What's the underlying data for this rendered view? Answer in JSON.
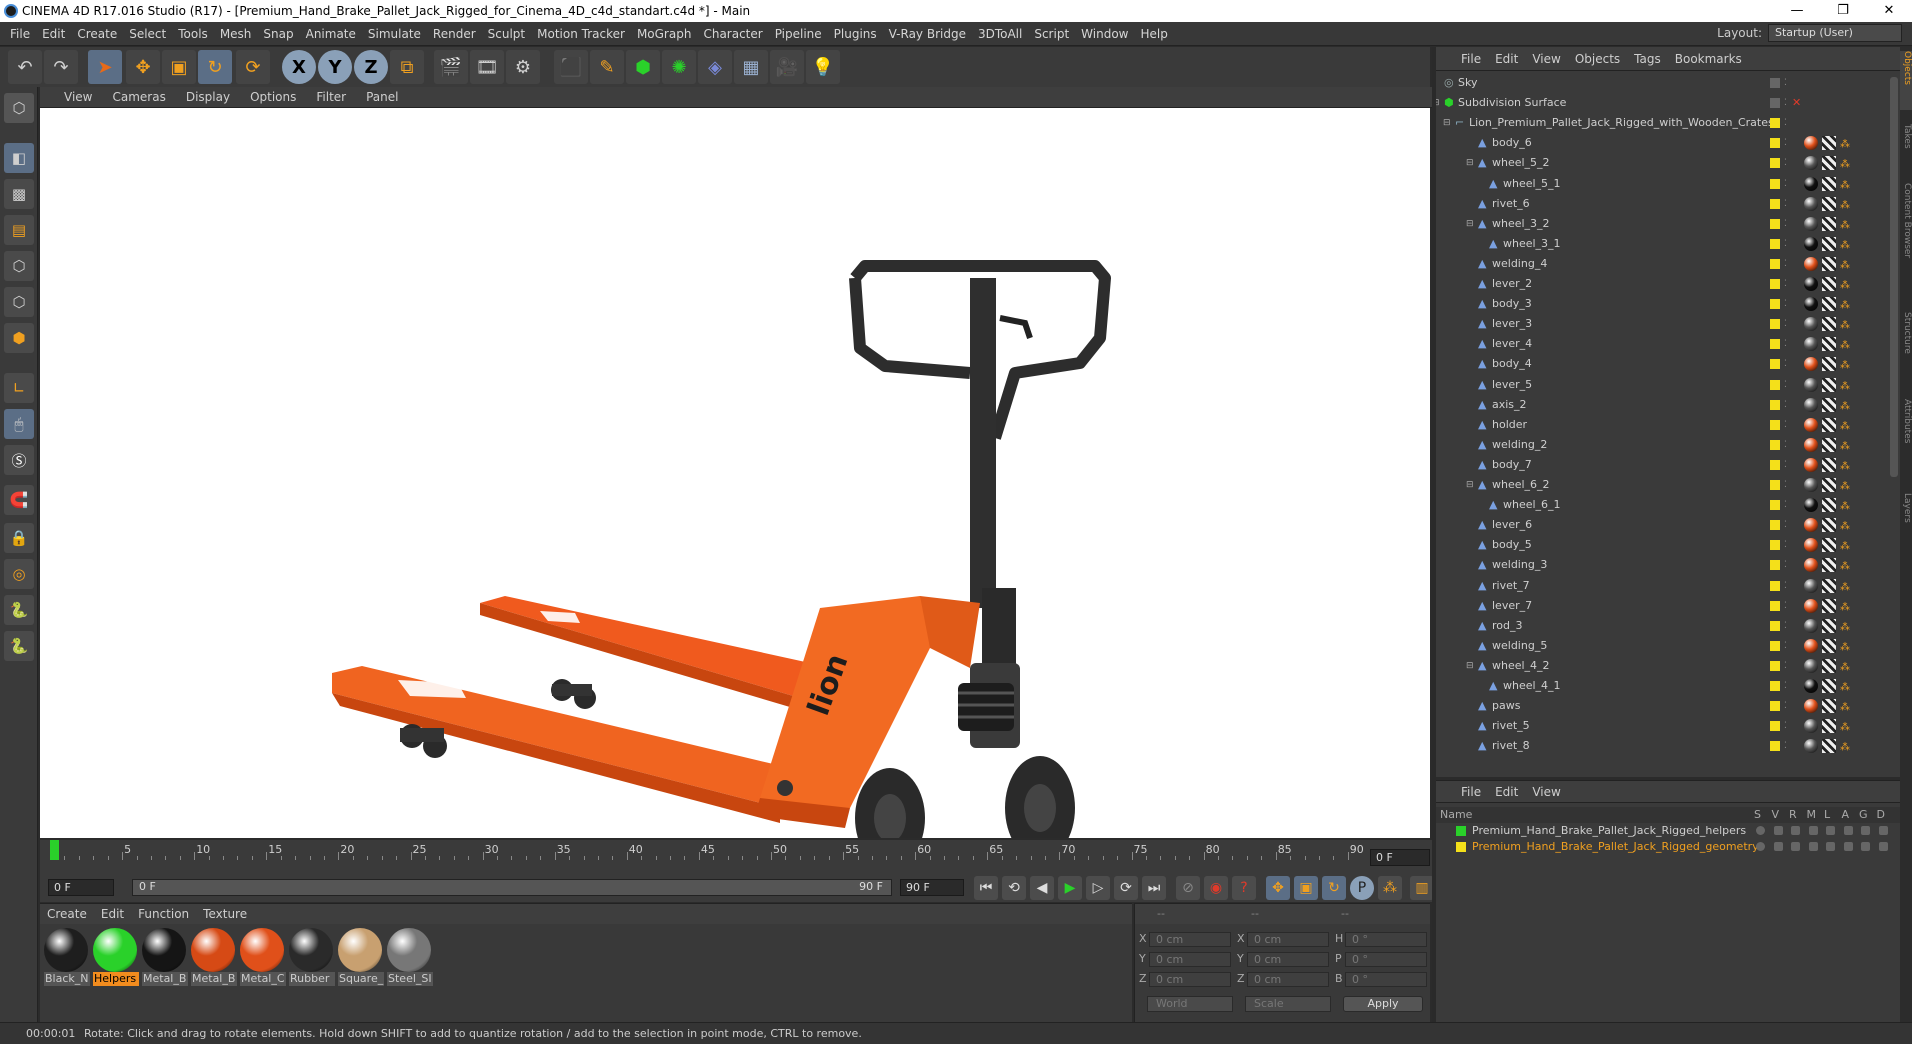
{
  "window": {
    "title": "CINEMA 4D R17.016 Studio (R17) - [Premium_Hand_Brake_Pallet_Jack_Rigged_for_Cinema_4D_c4d_standart.c4d *] - Main",
    "minimize": "—",
    "maximize": "❐",
    "close": "✕"
  },
  "menubar": {
    "items": [
      "File",
      "Edit",
      "Create",
      "Select",
      "Tools",
      "Mesh",
      "Snap",
      "Animate",
      "Simulate",
      "Render",
      "Sculpt",
      "Motion Tracker",
      "MoGraph",
      "Character",
      "Pipeline",
      "Plugins",
      "V-Ray Bridge",
      "3DToAll",
      "Script",
      "Window",
      "Help"
    ],
    "layout_label": "Layout:",
    "layout_value": "Startup (User)"
  },
  "viewport": {
    "menu": [
      "View",
      "Cameras",
      "Display",
      "Options",
      "Filter",
      "Panel"
    ],
    "brand_text": "lion"
  },
  "timeline": {
    "ticks": [
      "0",
      "5",
      "10",
      "15",
      "20",
      "25",
      "30",
      "35",
      "40",
      "45",
      "50",
      "55",
      "60",
      "65",
      "70",
      "75",
      "80",
      "85",
      "90"
    ],
    "current_frame": "0 F",
    "start": "0 F",
    "range_start": "0 F",
    "range_end": "90 F",
    "end": "90 F"
  },
  "materials": {
    "menu": [
      "Create",
      "Edit",
      "Function",
      "Texture"
    ],
    "items": [
      {
        "label": "Black_N",
        "color": "#1e1e1e"
      },
      {
        "label": "Helpers",
        "color": "#2ad12a",
        "selected": true
      },
      {
        "label": "Metal_B",
        "color": "#151515"
      },
      {
        "label": "Metal_B",
        "color": "#d64a15"
      },
      {
        "label": "Metal_C",
        "color": "#e0501a"
      },
      {
        "label": "Rubber",
        "color": "#2a2a2a"
      },
      {
        "label": "Square_",
        "color": "#c8a070"
      },
      {
        "label": "Steel_SI",
        "color": "#777777"
      }
    ]
  },
  "coords": {
    "header": [
      "--",
      "--",
      "--"
    ],
    "rows": [
      {
        "a": "X",
        "av": "0 cm",
        "b": "X",
        "bv": "0 cm",
        "c": "H",
        "cv": "0 °"
      },
      {
        "a": "Y",
        "av": "0 cm",
        "b": "Y",
        "bv": "0 cm",
        "c": "P",
        "cv": "0 °"
      },
      {
        "a": "Z",
        "av": "0 cm",
        "b": "Z",
        "bv": "0 cm",
        "c": "B",
        "cv": "0 °"
      }
    ],
    "world": "World",
    "scale": "Scale",
    "apply": "Apply"
  },
  "status": {
    "time": "00:00:01",
    "text": "Rotate: Click and drag to rotate elements. Hold down SHIFT to add to quantize rotation / add to the selection in point mode, CTRL to remove."
  },
  "objects": {
    "menu": [
      "File",
      "Edit",
      "View",
      "Objects",
      "Tags",
      "Bookmarks"
    ],
    "items": [
      {
        "name": "Sky",
        "indent": 0,
        "type": "sky"
      },
      {
        "name": "Subdivision Surface",
        "indent": 0,
        "type": "subd"
      },
      {
        "name": "Lion_Premium_Pallet_Jack_Rigged_with_Wooden_Crates",
        "indent": 1,
        "type": "null"
      },
      {
        "name": "body_6",
        "indent": 2,
        "tag": "orange"
      },
      {
        "name": "wheel_5_2",
        "indent": 2,
        "tag": "grey",
        "expand": true
      },
      {
        "name": "wheel_5_1",
        "indent": 3,
        "tag": "black"
      },
      {
        "name": "rivet_6",
        "indent": 2,
        "tag": "grey"
      },
      {
        "name": "wheel_3_2",
        "indent": 2,
        "tag": "grey",
        "expand": true
      },
      {
        "name": "wheel_3_1",
        "indent": 3,
        "tag": "black"
      },
      {
        "name": "welding_4",
        "indent": 2,
        "tag": "orange"
      },
      {
        "name": "lever_2",
        "indent": 2,
        "tag": "black"
      },
      {
        "name": "body_3",
        "indent": 2,
        "tag": "black"
      },
      {
        "name": "lever_3",
        "indent": 2,
        "tag": "grey"
      },
      {
        "name": "lever_4",
        "indent": 2,
        "tag": "grey"
      },
      {
        "name": "body_4",
        "indent": 2,
        "tag": "orange"
      },
      {
        "name": "lever_5",
        "indent": 2,
        "tag": "grey"
      },
      {
        "name": "axis_2",
        "indent": 2,
        "tag": "grey"
      },
      {
        "name": "holder",
        "indent": 2,
        "tag": "orange"
      },
      {
        "name": "welding_2",
        "indent": 2,
        "tag": "orange"
      },
      {
        "name": "body_7",
        "indent": 2,
        "tag": "orange"
      },
      {
        "name": "wheel_6_2",
        "indent": 2,
        "tag": "grey",
        "expand": true
      },
      {
        "name": "wheel_6_1",
        "indent": 3,
        "tag": "black"
      },
      {
        "name": "lever_6",
        "indent": 2,
        "tag": "orange"
      },
      {
        "name": "body_5",
        "indent": 2,
        "tag": "orange"
      },
      {
        "name": "welding_3",
        "indent": 2,
        "tag": "orange"
      },
      {
        "name": "rivet_7",
        "indent": 2,
        "tag": "grey"
      },
      {
        "name": "lever_7",
        "indent": 2,
        "tag": "orange"
      },
      {
        "name": "rod_3",
        "indent": 2,
        "tag": "grey"
      },
      {
        "name": "welding_5",
        "indent": 2,
        "tag": "orange"
      },
      {
        "name": "wheel_4_2",
        "indent": 2,
        "tag": "grey",
        "expand": true
      },
      {
        "name": "wheel_4_1",
        "indent": 3,
        "tag": "black"
      },
      {
        "name": "paws",
        "indent": 2,
        "tag": "orange"
      },
      {
        "name": "rivet_5",
        "indent": 2,
        "tag": "grey"
      },
      {
        "name": "rivet_8",
        "indent": 2,
        "tag": "grey"
      }
    ]
  },
  "layers": {
    "menu": [
      "File",
      "Edit",
      "View"
    ],
    "header": {
      "name": "Name",
      "cols": [
        "S",
        "V",
        "R",
        "M",
        "L",
        "A",
        "G",
        "D"
      ]
    },
    "items": [
      {
        "name": "Premium_Hand_Brake_Pallet_Jack_Rigged_helpers",
        "color": "#2ad12a",
        "text_color": "#cfcfcf"
      },
      {
        "name": "Premium_Hand_Brake_Pallet_Jack_Rigged_geometry",
        "color": "#f4e01a",
        "text_color": "#f0a020"
      }
    ]
  },
  "right_tabs": [
    "Objects",
    "Takes",
    "Content Browser",
    "Structure",
    "Attributes",
    "Layers"
  ]
}
